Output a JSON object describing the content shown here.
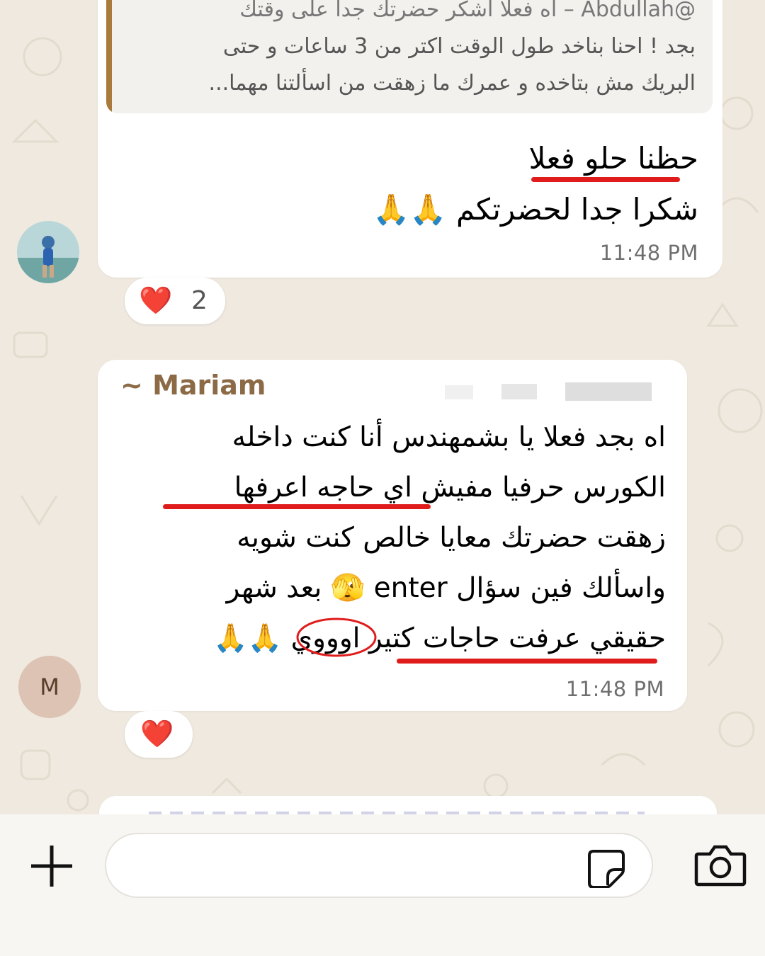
{
  "prev_message": {
    "quote_lines": [
      "@Abdullah – اه فعلا أشكر حضرتك جدا على وقتك",
      "بجد ! احنا بناخد طول الوقت اكتر من 3 ساعات و حتى",
      "البريك مش بتاخده و عمرك ما زهقت من اسألتنا مهما..."
    ],
    "text_lines": [
      "حظنا حلو فعلا",
      "شكرا جدا لحضرتكم 🙏🙏"
    ],
    "time": "11:48 PM",
    "reaction_emoji": "❤️",
    "reaction_count": "2"
  },
  "mariam_message": {
    "sender": "~ Mariam",
    "lines": [
      "اه بجد فعلا يا بشمهندس أنا كنت داخله",
      "الكورس حرفيا مفيش اي حاجه اعرفها",
      "زهقت حضرتك معايا خالص كنت شويه",
      "واسألك فين سؤال enter 🫣 بعد شهر",
      "حقيقي عرفت حاجات كتير اوووي 🙏🙏"
    ],
    "time": "11:48 PM",
    "avatar_letter": "M",
    "reaction_emoji": "❤️"
  },
  "composer": {
    "placeholder": "",
    "icons": [
      "plus-icon",
      "sticker-icon",
      "camera-icon"
    ]
  },
  "colors": {
    "bubble": "#ffffff",
    "wallpaper": "#efe9df",
    "sender_name": "#8b6a45",
    "quote_bar": "#a87a3c",
    "annotation_red": "#e01b1b",
    "avatar_m_bg": "#dcc3b3",
    "avatar_m_text": "#5a3d2b"
  }
}
